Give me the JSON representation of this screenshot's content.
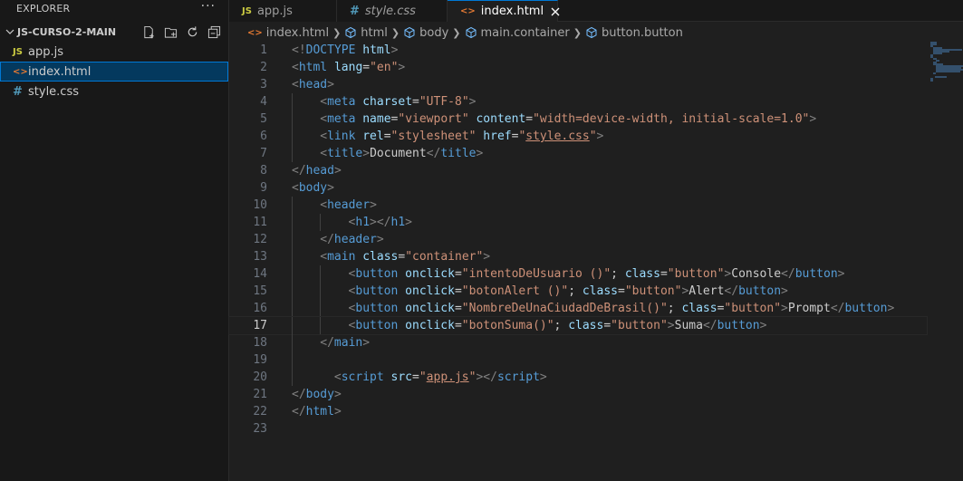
{
  "sidebar": {
    "title": "EXPLORER",
    "more_label": "···",
    "folder": {
      "name": "JS-CURSO-2-MAIN"
    },
    "files": [
      {
        "icon": "JS",
        "icon_type": "js",
        "label": "app.js",
        "active": false
      },
      {
        "icon": "<>",
        "icon_type": "html",
        "label": "index.html",
        "active": true
      },
      {
        "icon": "#",
        "icon_type": "css",
        "label": "style.css",
        "active": false
      }
    ]
  },
  "tabs": [
    {
      "icon": "JS",
      "icon_type": "js",
      "label": "app.js",
      "active": false,
      "italic": false
    },
    {
      "icon": "#",
      "icon_type": "css",
      "label": "style.css",
      "active": false,
      "italic": true
    },
    {
      "icon": "<>",
      "icon_type": "html",
      "label": "index.html",
      "active": true,
      "italic": false
    }
  ],
  "breadcrumbs": [
    "index.html",
    "html",
    "body",
    "main.container",
    "button.button"
  ],
  "editor": {
    "current_line": 17,
    "lines": [
      {
        "n": "1",
        "indent": 0,
        "tokens": [
          [
            "punc",
            "<!"
          ],
          [
            "tag",
            "DOCTYPE"
          ],
          [
            "text",
            " "
          ],
          [
            "attr",
            "html"
          ],
          [
            "punc",
            ">"
          ]
        ]
      },
      {
        "n": "2",
        "indent": 0,
        "tokens": [
          [
            "punc",
            "<"
          ],
          [
            "tag",
            "html"
          ],
          [
            "text",
            " "
          ],
          [
            "attr",
            "lang"
          ],
          [
            "text",
            "="
          ],
          [
            "str",
            "\"en\""
          ],
          [
            "punc",
            ">"
          ]
        ]
      },
      {
        "n": "3",
        "indent": 0,
        "tokens": [
          [
            "punc",
            "<"
          ],
          [
            "tag",
            "head"
          ],
          [
            "punc",
            ">"
          ]
        ]
      },
      {
        "n": "4",
        "indent": 1,
        "tokens": [
          [
            "punc",
            "<"
          ],
          [
            "tag",
            "meta"
          ],
          [
            "text",
            " "
          ],
          [
            "attr",
            "charset"
          ],
          [
            "text",
            "="
          ],
          [
            "str",
            "\"UTF-8\""
          ],
          [
            "punc",
            ">"
          ]
        ]
      },
      {
        "n": "5",
        "indent": 1,
        "tokens": [
          [
            "punc",
            "<"
          ],
          [
            "tag",
            "meta"
          ],
          [
            "text",
            " "
          ],
          [
            "attr",
            "name"
          ],
          [
            "text",
            "="
          ],
          [
            "str",
            "\"viewport\""
          ],
          [
            "text",
            " "
          ],
          [
            "attr",
            "content"
          ],
          [
            "text",
            "="
          ],
          [
            "str",
            "\"width=device-width, initial-scale=1.0\""
          ],
          [
            "punc",
            ">"
          ]
        ]
      },
      {
        "n": "6",
        "indent": 1,
        "tokens": [
          [
            "punc",
            "<"
          ],
          [
            "tag",
            "link"
          ],
          [
            "text",
            " "
          ],
          [
            "attr",
            "rel"
          ],
          [
            "text",
            "="
          ],
          [
            "str",
            "\"stylesheet\""
          ],
          [
            "text",
            " "
          ],
          [
            "attr",
            "href"
          ],
          [
            "text",
            "="
          ],
          [
            "str",
            "\""
          ],
          [
            "link",
            "style.css"
          ],
          [
            "str",
            "\""
          ],
          [
            "punc",
            ">"
          ]
        ]
      },
      {
        "n": "7",
        "indent": 1,
        "tokens": [
          [
            "punc",
            "<"
          ],
          [
            "tag",
            "title"
          ],
          [
            "punc",
            ">"
          ],
          [
            "text",
            "Document"
          ],
          [
            "punc",
            "</"
          ],
          [
            "tag",
            "title"
          ],
          [
            "punc",
            ">"
          ]
        ]
      },
      {
        "n": "8",
        "indent": 0,
        "tokens": [
          [
            "punc",
            "</"
          ],
          [
            "tag",
            "head"
          ],
          [
            "punc",
            ">"
          ]
        ]
      },
      {
        "n": "9",
        "indent": 0,
        "tokens": [
          [
            "punc",
            "<"
          ],
          [
            "tag",
            "body"
          ],
          [
            "punc",
            ">"
          ]
        ]
      },
      {
        "n": "10",
        "indent": 1,
        "tokens": [
          [
            "punc",
            "<"
          ],
          [
            "tag",
            "header"
          ],
          [
            "punc",
            ">"
          ]
        ]
      },
      {
        "n": "11",
        "indent": 2,
        "tokens": [
          [
            "punc",
            "<"
          ],
          [
            "tag",
            "h1"
          ],
          [
            "punc",
            "></"
          ],
          [
            "tag",
            "h1"
          ],
          [
            "punc",
            ">"
          ]
        ]
      },
      {
        "n": "12",
        "indent": 1,
        "tokens": [
          [
            "punc",
            "</"
          ],
          [
            "tag",
            "header"
          ],
          [
            "punc",
            ">"
          ]
        ]
      },
      {
        "n": "13",
        "indent": 1,
        "tokens": [
          [
            "punc",
            "<"
          ],
          [
            "tag",
            "main"
          ],
          [
            "text",
            " "
          ],
          [
            "attr",
            "class"
          ],
          [
            "text",
            "="
          ],
          [
            "str",
            "\"container\""
          ],
          [
            "punc",
            ">"
          ]
        ]
      },
      {
        "n": "14",
        "indent": 2,
        "tokens": [
          [
            "punc",
            "<"
          ],
          [
            "tag",
            "button"
          ],
          [
            "text",
            " "
          ],
          [
            "attr",
            "onclick"
          ],
          [
            "text",
            "="
          ],
          [
            "str",
            "\"intentoDeUsuario ()\""
          ],
          [
            "text",
            "; "
          ],
          [
            "attr",
            "class"
          ],
          [
            "text",
            "="
          ],
          [
            "str",
            "\"button\""
          ],
          [
            "punc",
            ">"
          ],
          [
            "text",
            "Console"
          ],
          [
            "punc",
            "</"
          ],
          [
            "tag",
            "button"
          ],
          [
            "punc",
            ">"
          ]
        ]
      },
      {
        "n": "15",
        "indent": 2,
        "tokens": [
          [
            "punc",
            "<"
          ],
          [
            "tag",
            "button"
          ],
          [
            "text",
            " "
          ],
          [
            "attr",
            "onclick"
          ],
          [
            "text",
            "="
          ],
          [
            "str",
            "\"botonAlert ()\""
          ],
          [
            "text",
            "; "
          ],
          [
            "attr",
            "class"
          ],
          [
            "text",
            "="
          ],
          [
            "str",
            "\"button\""
          ],
          [
            "punc",
            ">"
          ],
          [
            "text",
            "Alert"
          ],
          [
            "punc",
            "</"
          ],
          [
            "tag",
            "button"
          ],
          [
            "punc",
            ">"
          ]
        ]
      },
      {
        "n": "16",
        "indent": 2,
        "tokens": [
          [
            "punc",
            "<"
          ],
          [
            "tag",
            "button"
          ],
          [
            "text",
            " "
          ],
          [
            "attr",
            "onclick"
          ],
          [
            "text",
            "="
          ],
          [
            "str",
            "\"NombreDeUnaCiudadDeBrasil()\""
          ],
          [
            "text",
            "; "
          ],
          [
            "attr",
            "class"
          ],
          [
            "text",
            "="
          ],
          [
            "str",
            "\"button\""
          ],
          [
            "punc",
            ">"
          ],
          [
            "text",
            "Prompt"
          ],
          [
            "punc",
            "</"
          ],
          [
            "tag",
            "button"
          ],
          [
            "punc",
            ">"
          ]
        ]
      },
      {
        "n": "17",
        "indent": 2,
        "tokens": [
          [
            "punc",
            "<"
          ],
          [
            "tag",
            "button"
          ],
          [
            "text",
            " "
          ],
          [
            "attr",
            "onclick"
          ],
          [
            "text",
            "="
          ],
          [
            "str",
            "\"botonSuma()\""
          ],
          [
            "text",
            "; "
          ],
          [
            "attr",
            "class"
          ],
          [
            "text",
            "="
          ],
          [
            "str",
            "\"button\""
          ],
          [
            "punc",
            ">"
          ],
          [
            "text",
            "Suma"
          ],
          [
            "punc",
            "</"
          ],
          [
            "tag",
            "button"
          ],
          [
            "punc",
            ">"
          ]
        ]
      },
      {
        "n": "18",
        "indent": 1,
        "tokens": [
          [
            "punc",
            "</"
          ],
          [
            "tag",
            "main"
          ],
          [
            "punc",
            ">"
          ]
        ]
      },
      {
        "n": "19",
        "indent": 0,
        "tokens": []
      },
      {
        "n": "20",
        "indent": 1.5,
        "tokens": [
          [
            "punc",
            "<"
          ],
          [
            "tag",
            "script"
          ],
          [
            "text",
            " "
          ],
          [
            "attr",
            "src"
          ],
          [
            "text",
            "="
          ],
          [
            "str",
            "\""
          ],
          [
            "link",
            "app.js"
          ],
          [
            "str",
            "\""
          ],
          [
            "punc",
            "></"
          ],
          [
            "tag",
            "script"
          ],
          [
            "punc",
            ">"
          ]
        ]
      },
      {
        "n": "21",
        "indent": 0,
        "tokens": [
          [
            "punc",
            "</"
          ],
          [
            "tag",
            "body"
          ],
          [
            "punc",
            ">"
          ]
        ]
      },
      {
        "n": "22",
        "indent": 0,
        "tokens": [
          [
            "punc",
            "</"
          ],
          [
            "tag",
            "html"
          ],
          [
            "punc",
            ">"
          ]
        ]
      },
      {
        "n": "23",
        "indent": 0,
        "tokens": []
      }
    ]
  },
  "colors": {
    "accent": "#0078d4",
    "tag": "#569cd6",
    "attr": "#9cdcfe",
    "string": "#ce9178",
    "punctuation": "#808080"
  }
}
